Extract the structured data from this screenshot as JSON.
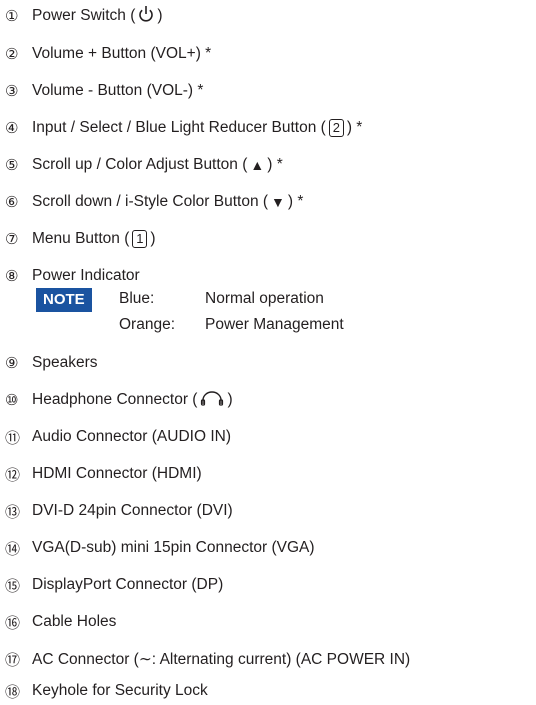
{
  "items": [
    {
      "num": "①",
      "pre": "Power Switch (",
      "icon": "power-icon",
      "post": ")"
    },
    {
      "num": "②",
      "text": "Volume + Button (VOL+) *"
    },
    {
      "num": "③",
      "text": "Volume - Button (VOL-) *"
    },
    {
      "num": "④",
      "pre": "Input / Select / Blue Light Reducer  Button (",
      "box": "2",
      "post": ") *"
    },
    {
      "num": "⑤",
      "pre": "Scroll up / Color Adjust Button (",
      "symbol": "▲",
      "post": ") *"
    },
    {
      "num": "⑥",
      "pre": "Scroll down / i-Style Color Button (",
      "symbol": "▼",
      "post": ") *"
    },
    {
      "num": "⑦",
      "pre": "Menu Button (",
      "box": "1",
      "post": ")"
    },
    {
      "num": "⑧",
      "text": "Power Indicator"
    },
    {
      "num": "⑨",
      "text": "Speakers"
    },
    {
      "num": "⑩",
      "pre": "Headphone Connector (",
      "icon": "headphone-icon",
      "post": ")"
    },
    {
      "num": "⑪",
      "text": "Audio Connector (AUDIO IN)"
    },
    {
      "num": "⑫",
      "text": "HDMI Connector (HDMI)"
    },
    {
      "num": "⑬",
      "text": "DVI-D 24pin Connector (DVI)"
    },
    {
      "num": "⑭",
      "text": "VGA(D-sub) mini 15pin Connector (VGA)"
    },
    {
      "num": "⑮",
      "text": "DisplayPort Connector (DP)"
    },
    {
      "num": "⑯",
      "text": "Cable Holes"
    },
    {
      "num": "⑰",
      "text": "AC Connector (∼: Alternating current) (AC POWER IN)"
    },
    {
      "num": "⑱",
      "text": "Keyhole for Security Lock"
    }
  ],
  "note": {
    "badge": "NOTE",
    "lines": [
      {
        "key": "Blue:",
        "value": "Normal operation"
      },
      {
        "key": "Orange:",
        "value": "Power Management"
      }
    ]
  },
  "colors": {
    "note_badge": "#1a53a0",
    "text": "#231f20"
  }
}
